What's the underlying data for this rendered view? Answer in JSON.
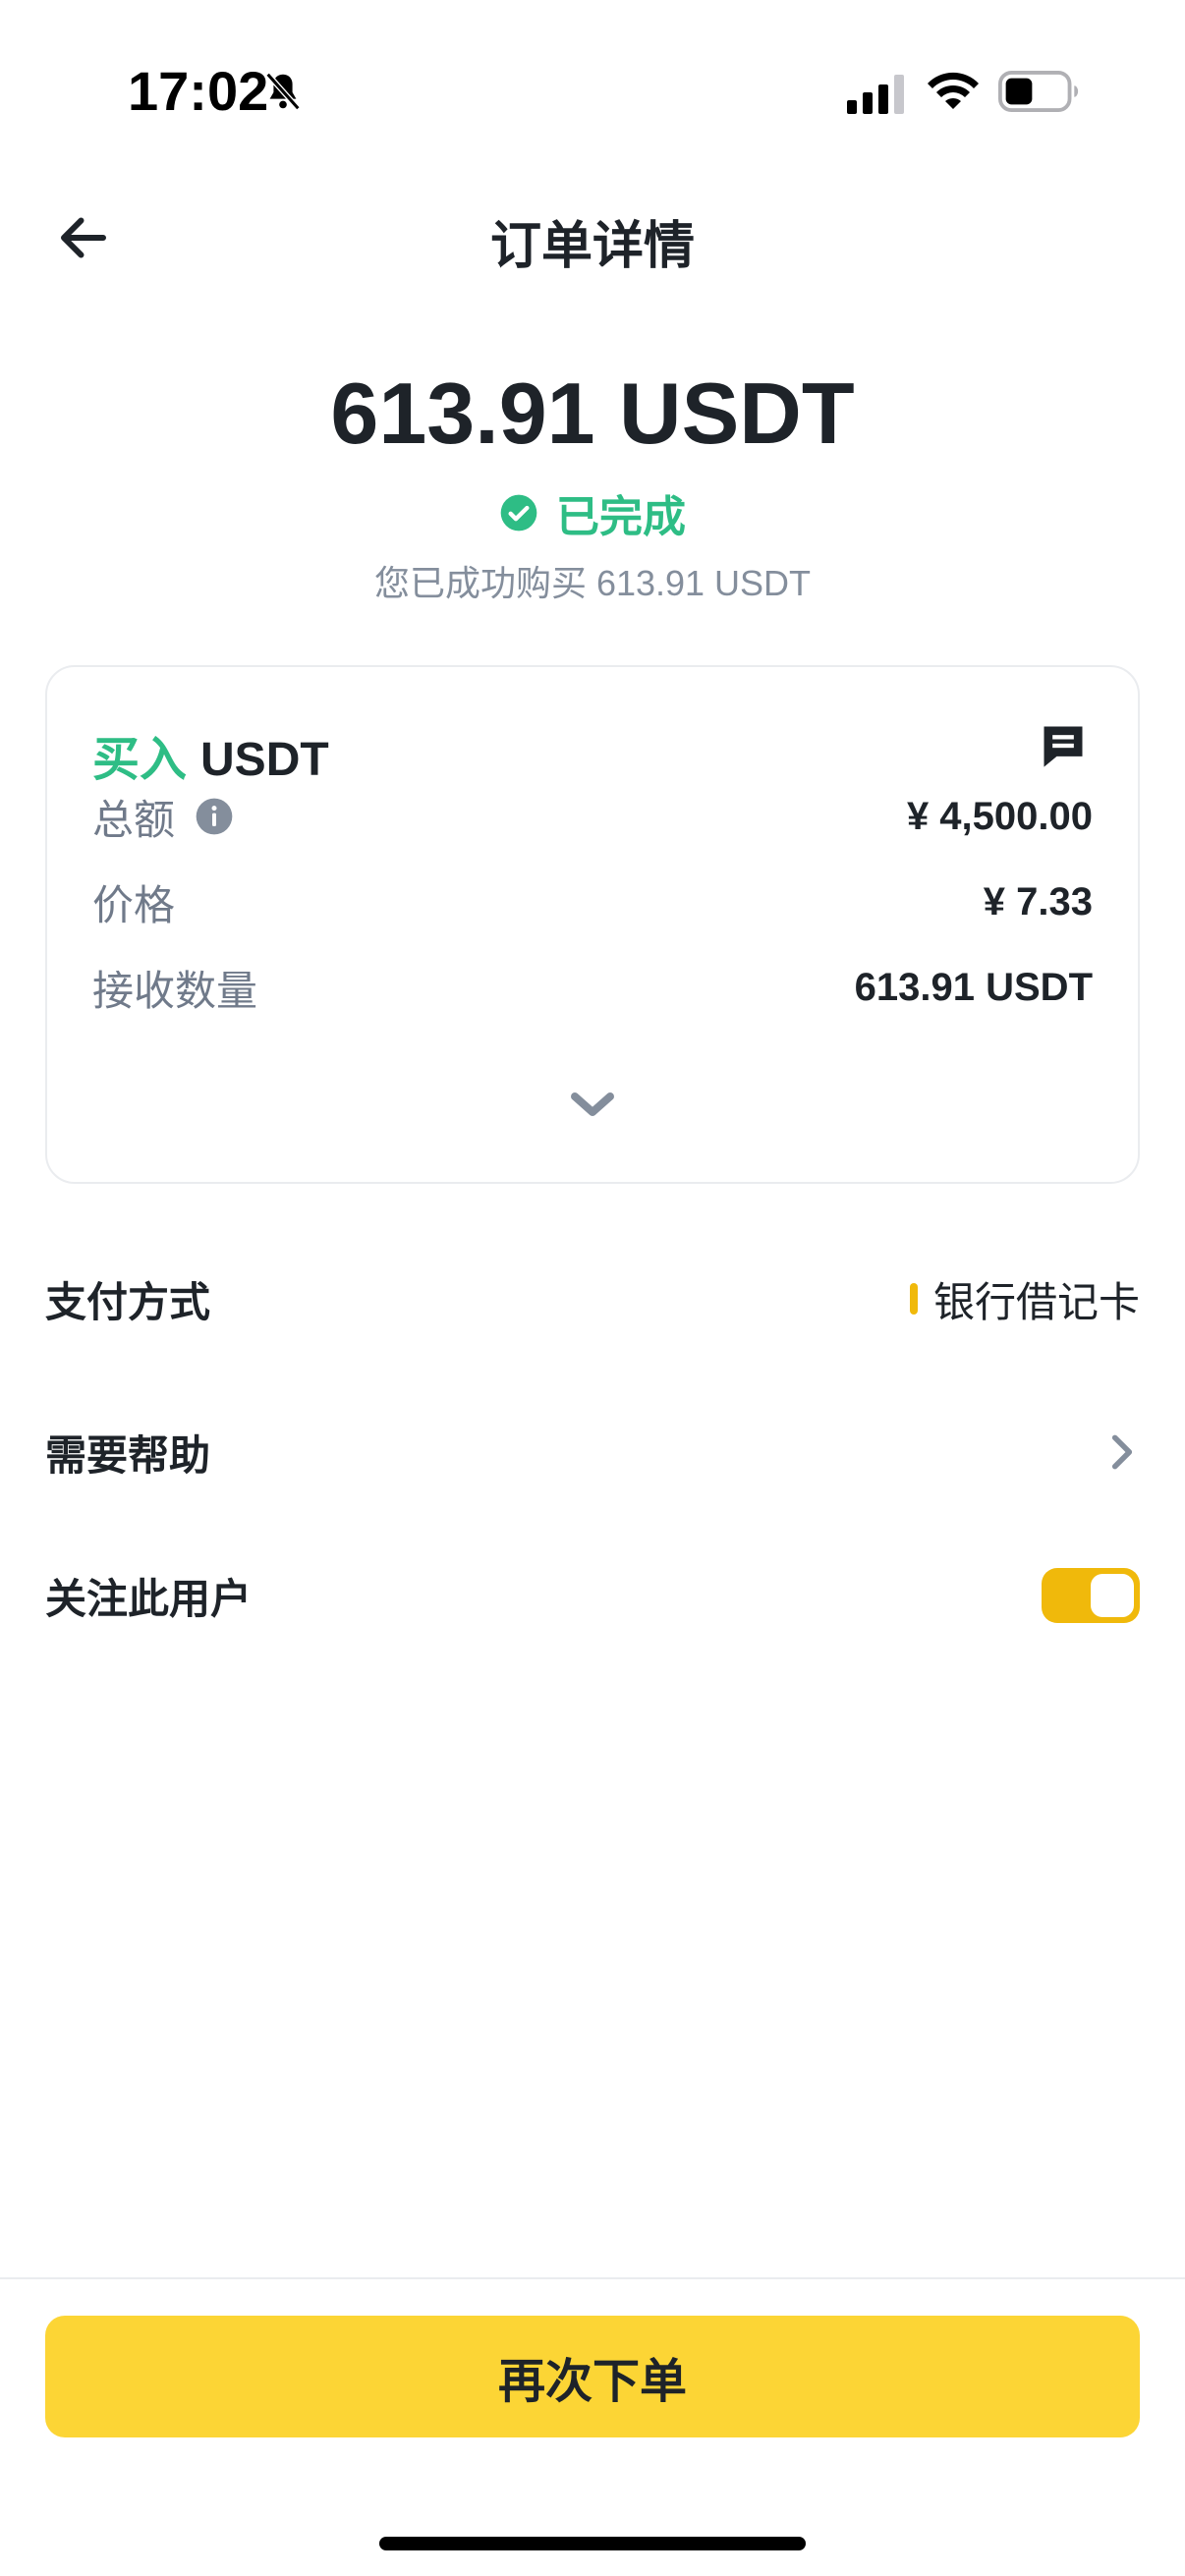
{
  "status_bar": {
    "time": "17:02"
  },
  "nav": {
    "title": "订单详情"
  },
  "summary": {
    "amount": "613.91 USDT",
    "status": "已完成",
    "message": "您已成功购买 613.91 USDT"
  },
  "card": {
    "side": "买入",
    "asset": "USDT",
    "rows": [
      {
        "label": "总额",
        "value": "¥ 4,500.00"
      },
      {
        "label": "价格",
        "value": "¥ 7.33"
      },
      {
        "label": "接收数量",
        "value": "613.91 USDT"
      }
    ]
  },
  "settings": {
    "payment_method_label": "支付方式",
    "payment_method_value": "银行借记卡",
    "help_label": "需要帮助",
    "follow_label": "关注此用户",
    "follow_enabled": true
  },
  "footer": {
    "reorder_label": "再次下单"
  },
  "colors": {
    "accent_yellow": "#fcd535",
    "toggle_yellow": "#f0b90b",
    "success_green": "#2ebd85",
    "text_primary": "#1e2329",
    "text_secondary": "#848e9c"
  },
  "icons": [
    "bell-slash-icon",
    "signal-icon",
    "wifi-icon",
    "battery-icon",
    "back-arrow-icon",
    "check-circle-icon",
    "chat-icon",
    "info-icon",
    "chevron-down-icon",
    "chevron-right-icon"
  ]
}
